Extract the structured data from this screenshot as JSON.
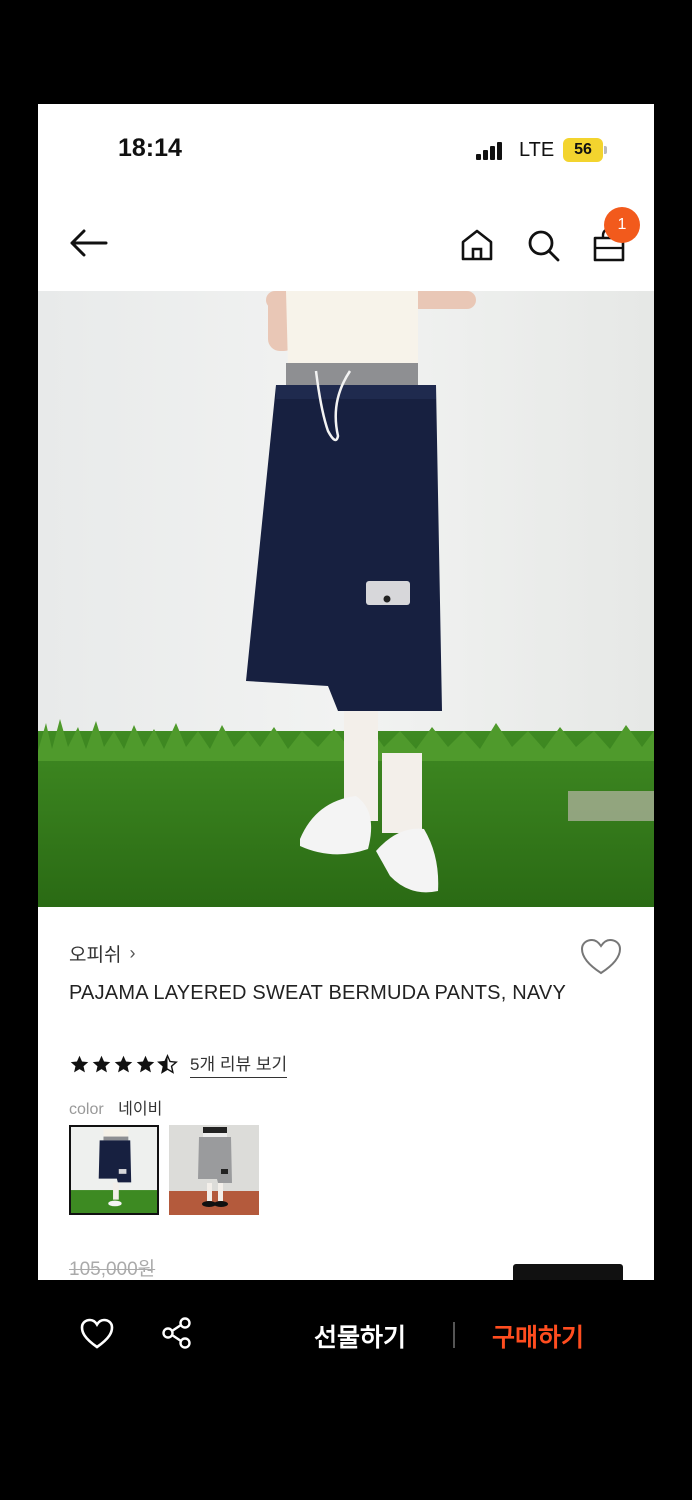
{
  "status_bar": {
    "time": "18:14",
    "network": "LTE",
    "battery": "56"
  },
  "nav": {
    "cart_count": "1"
  },
  "product": {
    "brand": "오피쉬",
    "title": "PAJAMA LAYERED SWEAT BERMUDA PANTS, NAVY",
    "rating": 4.5,
    "review_link": "5개 리뷰 보기",
    "color_label": "color",
    "color_value": "네이비",
    "original_price": "105,000원"
  },
  "bottom_bar": {
    "gift_label": "선물하기",
    "buy_label": "구매하기"
  },
  "colors": {
    "accent": "#f25a1c",
    "buy": "#ff4d1f",
    "battery": "#f3d42e"
  },
  "icons": [
    "back-arrow-icon",
    "home-icon",
    "search-icon",
    "shopping-bag-icon",
    "heart-icon",
    "share-icon",
    "star-icon"
  ]
}
